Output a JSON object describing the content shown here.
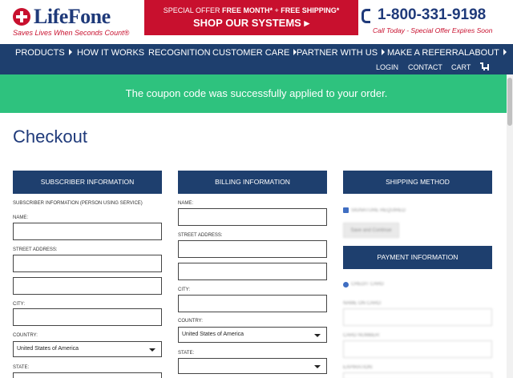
{
  "header": {
    "brand": "LifeFone",
    "tagline": "Saves Lives When Seconds Count®",
    "offer_prefix": "SPECIAL OFFER ",
    "offer_bold1": "FREE MONTH*",
    "offer_mid": " + ",
    "offer_bold2": "FREE SHIPPING*",
    "offer_cta": "SHOP OUR SYSTEMS ▸",
    "phone": "1-800-331-9198",
    "phone_sub": "Call Today - Special Offer Expires Soon"
  },
  "nav": {
    "products": "PRODUCTS",
    "how": "HOW IT WORKS",
    "recognition": "RECOGNITION",
    "care": "CUSTOMER CARE",
    "partner": "PARTNER WITH US",
    "referral": "MAKE A REFERRAL",
    "about": "ABOUT",
    "login": "LOGIN",
    "contact": "CONTACT",
    "cart": "CART"
  },
  "banner": "The coupon code was successfully applied to your order.",
  "page_title": "Checkout",
  "subscriber": {
    "heading": "SUBSCRIBER INFORMATION",
    "intro": "SUBSCRIBER INFORMATION (PERSON USING SERVICE)",
    "name_label": "NAME:",
    "street_label": "STREET ADDRESS:",
    "city_label": "CITY:",
    "country_label": "COUNTRY:",
    "country_value": "United States of America",
    "state_label": "STATE:"
  },
  "billing": {
    "heading": "BILLING INFORMATION",
    "name_label": "NAME:",
    "street_label": "STREET ADDRESS:",
    "city_label": "CITY:",
    "country_label": "COUNTRY:",
    "country_value": "United States of America",
    "state_label": "STATE:"
  },
  "shipping": {
    "heading": "SHIPPING METHOD",
    "option": "SIGNATURE REQUIRED",
    "save_button": "Save and Continue"
  },
  "payment": {
    "heading": "PAYMENT INFORMATION",
    "method": "CREDIT CARD",
    "name_label": "NAME ON CARD:",
    "card_label": "CARD NUMBER:",
    "exp_label": "EXPIRATION:"
  },
  "icons": {
    "logo": "red-cross-logo-icon",
    "phone": "phone-icon",
    "cart": "cart-icon",
    "caret": "caret-right-icon",
    "dropdown": "chevron-down-icon"
  },
  "colors": {
    "navy": "#1e3f6e",
    "red": "#c8102e",
    "green": "#2ec27e"
  }
}
